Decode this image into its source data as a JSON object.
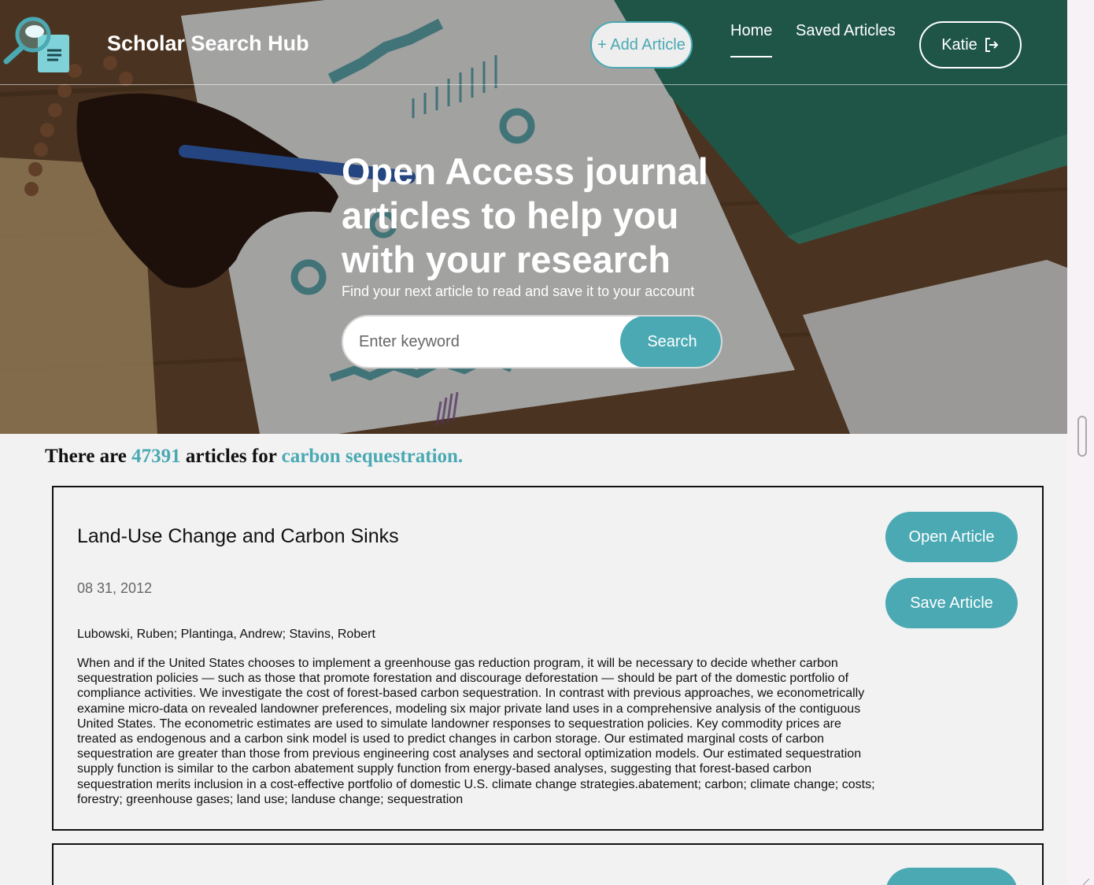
{
  "brand": {
    "name": "Scholar Search Hub"
  },
  "nav": {
    "add_article": "+ Add Article",
    "home": "Home",
    "saved_articles": "Saved Articles",
    "user": "Katie"
  },
  "hero": {
    "title": "Open Access journal articles to help you with your research",
    "subtitle": "Find your next article to read and save it to your account",
    "search_placeholder": "Enter keyword",
    "search_button": "Search"
  },
  "results": {
    "prefix": "There are",
    "count": "47391",
    "middle": "articles for",
    "query": "carbon sequestration."
  },
  "articles": [
    {
      "title": "Land-Use Change and Carbon Sinks",
      "date": "08 31, 2012",
      "authors": "Lubowski, Ruben; Plantinga, Andrew; Stavins, Robert",
      "abstract": "When and if the United States chooses to implement a greenhouse gas reduction program, it will be necessary to decide whether carbon sequestration policies — such as those that promote forestation and discourage deforestation — should be part of the domestic portfolio of compliance activities. We investigate the cost of forest-based carbon sequestration. In contrast with previous approaches, we econometrically examine micro-data on revealed landowner preferences, modeling six major private land uses in a comprehensive analysis of the contiguous United States. The econometric estimates are used to simulate landowner responses to sequestration policies. Key commodity prices are treated as endogenous and a carbon sink model is used to predict changes in carbon storage. Our estimated marginal costs of carbon sequestration are greater than those from previous engineering cost analyses and sectoral optimization models. Our estimated sequestration supply function is similar to the carbon abatement supply function from energy-based analyses, suggesting that forest-based carbon sequestration merits inclusion in a cost-effective portfolio of domestic U.S. climate change strategies.abatement; carbon; climate change; costs; forestry; greenhouse gases; land use; landuse change; sequestration",
      "open_label": "Open Article",
      "save_label": "Save Article"
    }
  ],
  "colors": {
    "accent": "#4aa9b3",
    "background": "#f2f2f2"
  },
  "icons": {
    "logo": "magnifier-document-logo",
    "logout": "logout-icon"
  }
}
